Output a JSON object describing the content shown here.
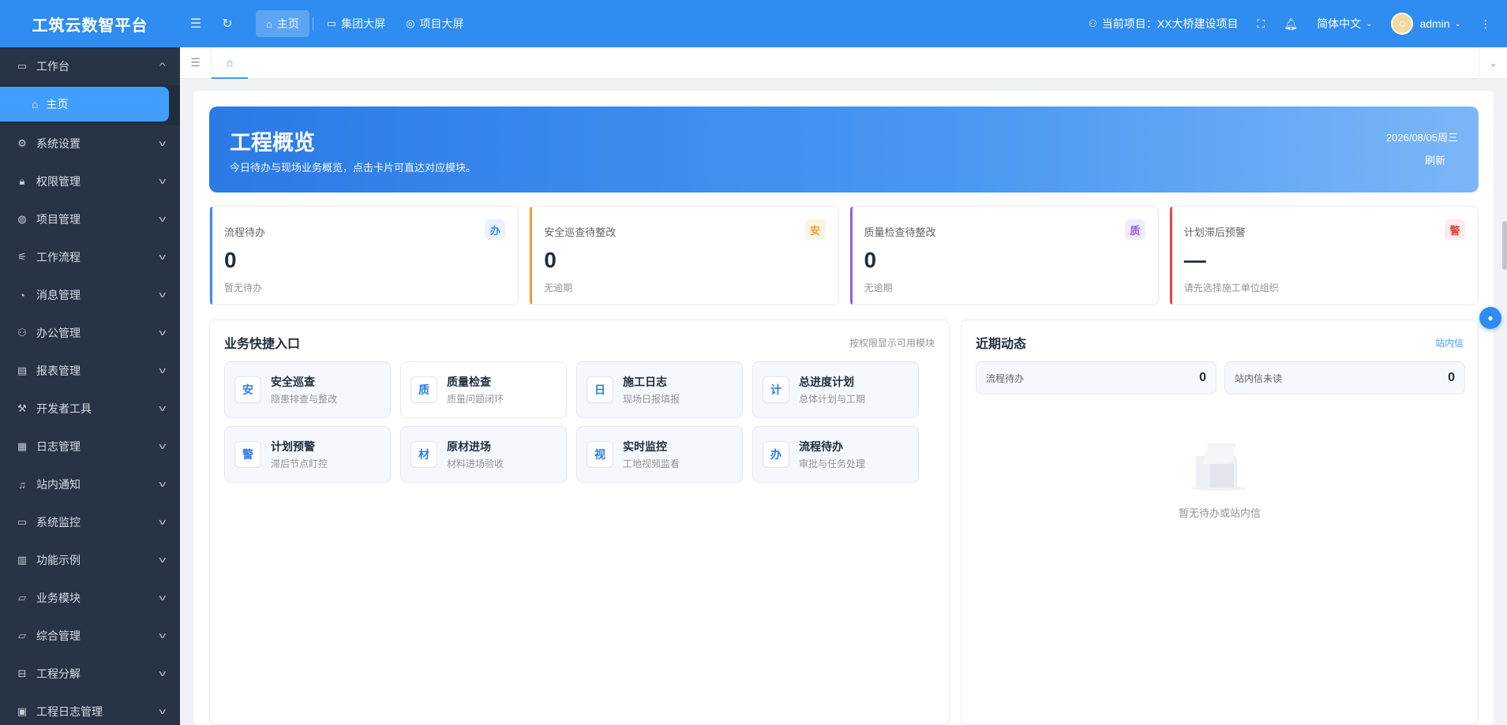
{
  "header": {
    "brand": "工筑云数智平台",
    "tabs": [
      {
        "label": "主页",
        "icon": "home-icon"
      },
      {
        "label": "集团大屏",
        "icon": "monitor-icon"
      },
      {
        "label": "项目大屏",
        "icon": "location-icon"
      }
    ],
    "current_project": "当前项目：XX大桥建设项目",
    "language": "简体中文",
    "user": "admin"
  },
  "sidebar": {
    "items": [
      {
        "label": "工作台",
        "icon": "monitor-icon",
        "expanded": true,
        "children": [
          {
            "label": "主页",
            "icon": "home-icon",
            "active": true
          }
        ]
      },
      {
        "label": "系统设置",
        "icon": "gear-icon"
      },
      {
        "label": "权限管理",
        "icon": "lock-icon"
      },
      {
        "label": "项目管理",
        "icon": "globe-icon"
      },
      {
        "label": "工作流程",
        "icon": "flow-icon"
      },
      {
        "label": "消息管理",
        "icon": "chat-icon"
      },
      {
        "label": "办公管理",
        "icon": "user-icon"
      },
      {
        "label": "报表管理",
        "icon": "report-icon"
      },
      {
        "label": "开发者工具",
        "icon": "tool-icon"
      },
      {
        "label": "日志管理",
        "icon": "log-icon"
      },
      {
        "label": "站内通知",
        "icon": "bell-icon"
      },
      {
        "label": "系统监控",
        "icon": "monitor-icon"
      },
      {
        "label": "功能示例",
        "icon": "grid-icon"
      },
      {
        "label": "业务模块",
        "icon": "folder-icon"
      },
      {
        "label": "综合管理",
        "icon": "folder-icon"
      },
      {
        "label": "工程分解",
        "icon": "structure-icon"
      },
      {
        "label": "工程日志管理",
        "icon": "calendar-icon"
      }
    ]
  },
  "banner": {
    "title": "工程概览",
    "subtitle": "今日待办与现场业务概览，点击卡片可直达对应模块。",
    "date": "2026/08/05周三",
    "refresh": "刷新"
  },
  "stats": [
    {
      "label": "流程待办",
      "badge": "办",
      "value": "0",
      "note": "暂无待办",
      "color": "#3d8cf0",
      "badge_bg": "#e9f2fe"
    },
    {
      "label": "安全巡查待整改",
      "badge": "安",
      "value": "0",
      "note": "无逾期",
      "color": "#f0a030",
      "badge_bg": "#fdf3e4"
    },
    {
      "label": "质量检查待整改",
      "badge": "质",
      "value": "0",
      "note": "无逾期",
      "color": "#9b5de5",
      "badge_bg": "#f2ebfc"
    },
    {
      "label": "计划滞后预警",
      "badge": "警",
      "value": "—",
      "note": "请先选择施工单位组织",
      "color": "#e0474c",
      "badge_bg": "#fdecec"
    }
  ],
  "quick": {
    "title": "业务快捷入口",
    "extra": "按权限显示可用模块",
    "items": [
      {
        "icon": "安",
        "title": "安全巡查",
        "desc": "隐患排查与整改"
      },
      {
        "icon": "质",
        "title": "质量检查",
        "desc": "质量问题闭环"
      },
      {
        "icon": "日",
        "title": "施工日志",
        "desc": "现场日报填报"
      },
      {
        "icon": "计",
        "title": "总进度计划",
        "desc": "总体计划与工期"
      },
      {
        "icon": "警",
        "title": "计划预警",
        "desc": "滞后节点盯控"
      },
      {
        "icon": "材",
        "title": "原材进场",
        "desc": "材料进场验收"
      },
      {
        "icon": "视",
        "title": "实时监控",
        "desc": "工地视频监看"
      },
      {
        "icon": "办",
        "title": "流程待办",
        "desc": "审批与任务处理"
      }
    ]
  },
  "recent": {
    "title": "近期动态",
    "link": "站内信",
    "stats": [
      {
        "label": "流程待办",
        "value": "0"
      },
      {
        "label": "站内信未读",
        "value": "0"
      }
    ],
    "empty": "暂无待办或站内信"
  }
}
